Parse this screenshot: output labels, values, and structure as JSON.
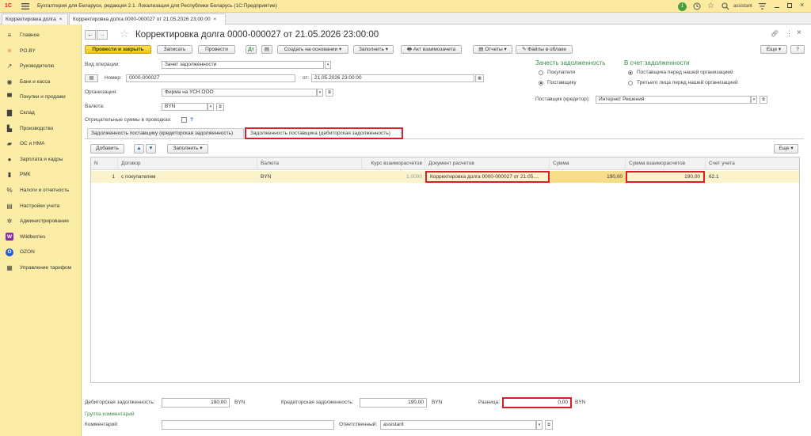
{
  "titlebar": {
    "app_title": "Бухгалтерия для Беларуси, редакция 2.1. Локализация для Республики Беларусь    (1С:Предприятие)",
    "user": "assistant",
    "notif_count": "1"
  },
  "tabs": [
    {
      "label": "Корректировка долга"
    },
    {
      "label": "Корректировка долга 0000-000027 от 21.05.2026 23:00:00"
    }
  ],
  "sidebar": {
    "items": [
      {
        "label": "Главное",
        "icon": "menu-icon"
      },
      {
        "label": "PO.BY",
        "icon": "star-icon"
      },
      {
        "label": "Руководителю",
        "icon": "chart-icon"
      },
      {
        "label": "Банк и касса",
        "icon": "bank-icon"
      },
      {
        "label": "Покупки и продажи",
        "icon": "cart-icon"
      },
      {
        "label": "Склад",
        "icon": "warehouse-icon"
      },
      {
        "label": "Производство",
        "icon": "factory-icon"
      },
      {
        "label": "ОС и НМА",
        "icon": "truck-icon"
      },
      {
        "label": "Зарплата и кадры",
        "icon": "person-icon"
      },
      {
        "label": "РМК",
        "icon": "register-icon"
      },
      {
        "label": "Налоги и отчетность",
        "icon": "percent-icon"
      },
      {
        "label": "Настройки учета",
        "icon": "settings-icon"
      },
      {
        "label": "Администрирование",
        "icon": "gear-icon"
      },
      {
        "label": "Wildberries",
        "icon": "wildberries-icon"
      },
      {
        "label": "OZON",
        "icon": "ozon-icon"
      },
      {
        "label": "Управление тарифом",
        "icon": "tariff-icon"
      }
    ]
  },
  "doc": {
    "title": "Корректировка долга 0000-000027 от 21.05.2026 23:00:00"
  },
  "toolbar": {
    "post_close": "Провести и закрыть",
    "save": "Записать",
    "post": "Провести",
    "create_basis": "Создать на основании",
    "fill": "Заполнить",
    "reconcile": "Акт взаимозачета",
    "reports": "Отчеты",
    "files": "Файлы в облаке",
    "more": "Еще",
    "help": "?"
  },
  "form": {
    "op_label": "Вид операции:",
    "op_value": "Зачет задолженности",
    "number_label": "Номер:",
    "number_value": "0000-000027",
    "date_label": "от:",
    "date_value": "21.05.2026 23:00:00",
    "org_label": "Организация:",
    "org_value": "Фирма на УСН ООО",
    "currency_label": "Валюта:",
    "currency_value": "BYN",
    "negative_label": "Отрицательные суммы в проводках:",
    "negative_help": "?",
    "offset_title": "Зачесть задолженность",
    "offset_buyer": "Покупателя",
    "offset_supplier": "Поставщику",
    "account_title": "В счет задолженности",
    "account_supplier": "Поставщика перед нашей организацией",
    "account_third": "Третьего лица перед нашей организацией",
    "supplier_label": "Поставщик (кредитор):",
    "supplier_value": "Интернет Решения"
  },
  "subtabs": {
    "tab1": "Задолженность поставщику (кредиторская задолженность)",
    "tab2": "Задолженность поставщика (дебиторская задолженность)"
  },
  "table_toolbar": {
    "add": "Добавить",
    "fill": "Заполнить",
    "more": "Еще"
  },
  "table": {
    "headers": [
      "N",
      "Договор",
      "Валюта",
      "Курс взаиморасчетов",
      "Документ расчетов",
      "Сумма",
      "Сумма взаиморасчетов",
      "Счет учета"
    ],
    "rows": [
      [
        "1",
        "с покупателем",
        "BYN",
        "1,0000",
        "Корректировка долга 0000-000027 от 21.05....",
        "190,00",
        "190,00",
        "62.1"
      ]
    ]
  },
  "footer": {
    "debit_label": "Дебиторская задолженность:",
    "debit_value": "190,00",
    "debit_cur": "BYN",
    "credit_label": "Кредиторская задолженность:",
    "credit_value": "190,00",
    "credit_cur": "BYN",
    "diff_label": "Разница:",
    "diff_value": "0,00",
    "diff_cur": "BYN",
    "comments_group": "Группа комментарий",
    "comment_label": "Комментарий:",
    "comment_value": "",
    "responsible_label": "Ответственный:",
    "responsible_value": "assistant"
  }
}
